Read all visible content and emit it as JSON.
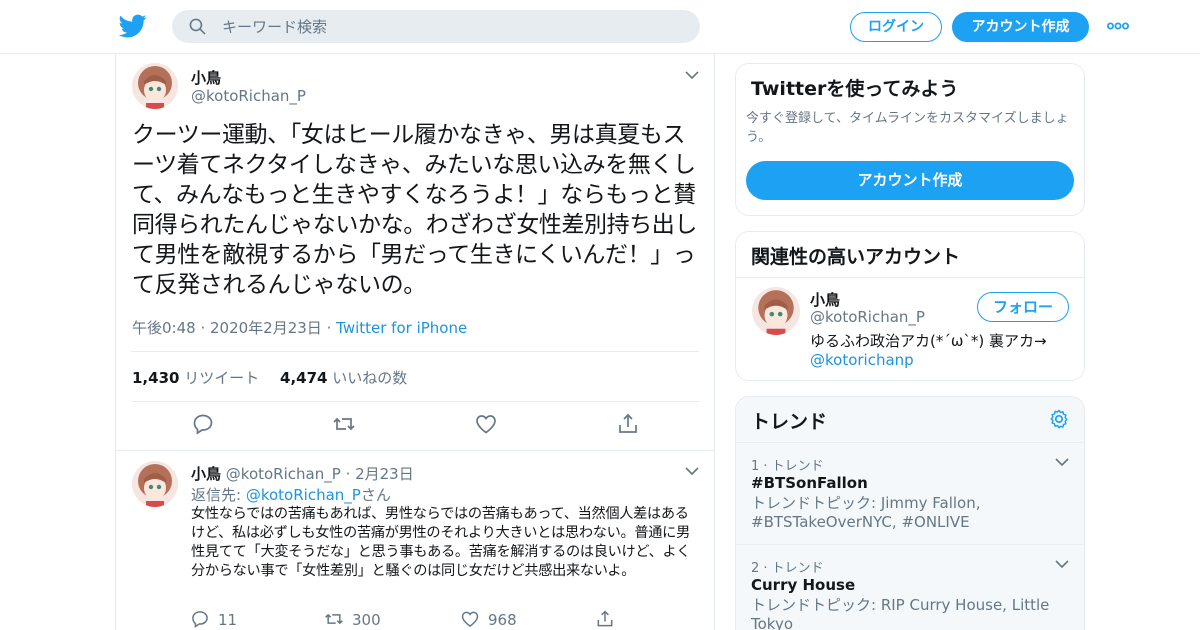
{
  "header": {
    "search_placeholder": "キーワード検索",
    "login_label": "ログイン",
    "signup_label": "アカウント作成"
  },
  "main_tweet": {
    "name": "小鳥",
    "handle": "@kotoRichan_P",
    "text": "クーツー運動、「女はヒール履かなきゃ、男は真夏もスーツ着てネクタイしなきゃ、みたいな思い込みを無くして、みんなもっと生きやすくなろうよ！」ならもっと賛同得られたんじゃないかな。わざわざ女性差別持ち出して男性を敵視するから「男だって生きにくいんだ！」って反発されるんじゃないの。",
    "time": "午後0:48 · 2020年2月23日",
    "separator": "·",
    "source": "Twitter for iPhone",
    "retweet_count": "1,430",
    "retweet_label": "リツイート",
    "like_count": "4,474",
    "like_label": "いいねの数"
  },
  "reply_tweet": {
    "name": "小鳥",
    "handle": "@kotoRichan_P",
    "date": "· 2月23日",
    "reply_to_prefix": "返信先:",
    "reply_to_handle": "@kotoRichan_P",
    "reply_to_suffix": "さん",
    "text": "女性ならではの苦痛もあれば、男性ならではの苦痛もあって、当然個人差はあるけど、私は必ずしも女性の苦痛が男性のそれより大きいとは思わない。普通に男性見てて「大変そうだな」と思う事もある。苦痛を解消するのは良いけど、よく分からない事で「女性差別」と騒ぐのは同じ女だけど共感出来ないよ。",
    "reply_count": "11",
    "retweet_count": "300",
    "like_count": "968"
  },
  "signup_card": {
    "title": "Twitterを使ってみよう",
    "subtitle": "今すぐ登録して、タイムラインをカスタマイズしましょう。",
    "button_label": "アカウント作成"
  },
  "related_card": {
    "title": "関連性の高いアカウント",
    "name": "小鳥",
    "handle": "@kotoRichan_P",
    "follow_label": "フォロー",
    "bio": "ゆるふわ政治アカ(*´ω`*) 裏アカ→",
    "bio_link": "@kotorichanp"
  },
  "trends_card": {
    "title": "トレンド",
    "items": [
      {
        "rank": "1 · トレンド",
        "tag": "#BTSonFallon",
        "topics": "トレンドトピック: Jimmy Fallon, #BTSTakeOverNYC, #ONLIVE"
      },
      {
        "rank": "2 · トレンド",
        "tag": "Curry House",
        "topics": "トレンドトピック: RIP Curry House, Little Tokyo"
      }
    ]
  },
  "colors": {
    "brand_blue": "#1da1f2",
    "link_blue": "#1b95e0",
    "muted_gray": "#657786",
    "border": "#e6ecf0"
  }
}
